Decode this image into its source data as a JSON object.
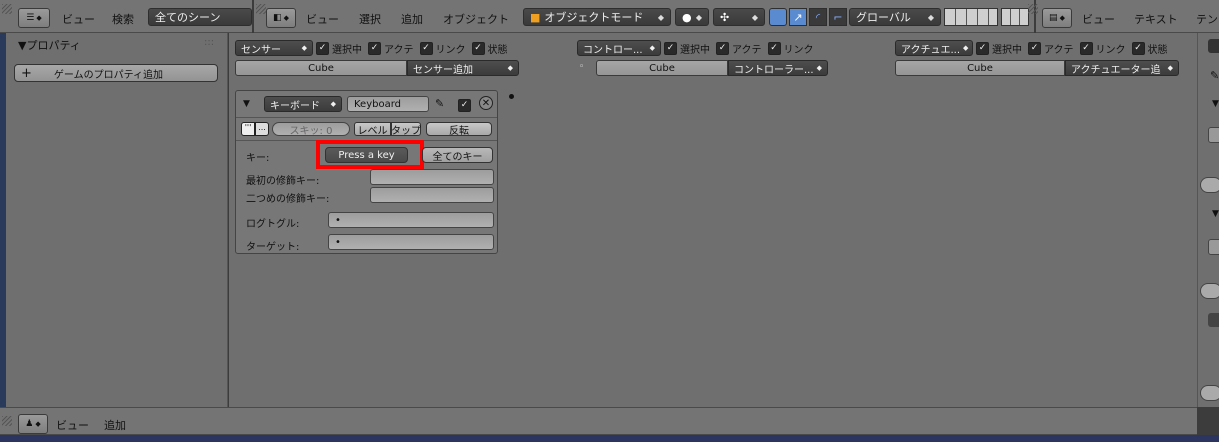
{
  "left_header": {
    "menu_view": "ビュー",
    "menu_search": "検索",
    "scene_select": "全てのシーン"
  },
  "view_header": {
    "menu_view": "ビュー",
    "menu_select": "選択",
    "menu_add": "追加",
    "menu_object": "オブジェクト",
    "mode_select": "オブジェクトモード",
    "orientation_select": "グローバル"
  },
  "right_header": {
    "menu_view": "ビュー",
    "menu_text": "テキスト",
    "menu_cut": "テン"
  },
  "properties": {
    "title": "▼プロパティ",
    "add_game_property": "ゲームのプロパティ追加"
  },
  "logic": {
    "sensor_col": {
      "filter_select": "センサー",
      "cb_selected": "選択中",
      "cb_active": "アクテ",
      "cb_link": "リンク",
      "cb_state": "状態",
      "object_name": "Cube",
      "add_select": "センサー追加"
    },
    "controller_col": {
      "filter_select": "コントロー...",
      "cb_selected": "選択中",
      "cb_active": "アクテ",
      "cb_link": "リンク",
      "object_name": "Cube",
      "add_select": "コントローラー..."
    },
    "actuator_col": {
      "filter_select": "アクチュエ...",
      "cb_selected": "選択中",
      "cb_active": "アクテ",
      "cb_link": "リンク",
      "cb_state": "状態",
      "object_name": "Cube",
      "add_select": "アクチュエーター追"
    },
    "sensor": {
      "type_select": "キーボード",
      "name": "Keyboard",
      "skip_label": "スキッ: 0",
      "level_button": "レベル",
      "tap_button": "タップ",
      "invert_button": "反転",
      "key_label": "キー:",
      "key_button": "Press a key",
      "all_keys_button": "全てのキー",
      "first_modifier_label": "最初の修飾キー:",
      "second_modifier_label": "二つめの修飾キー:",
      "log_toggle_label": "ログトグル:",
      "log_toggle_value": "•",
      "target_label": "ターゲット:",
      "target_value": "•"
    }
  },
  "bottom_header": {
    "menu_view": "ビュー",
    "menu_add": "追加"
  },
  "colors": {
    "highlight": "#ff0000",
    "panel": "#6f6f6f",
    "header": "#747474"
  }
}
